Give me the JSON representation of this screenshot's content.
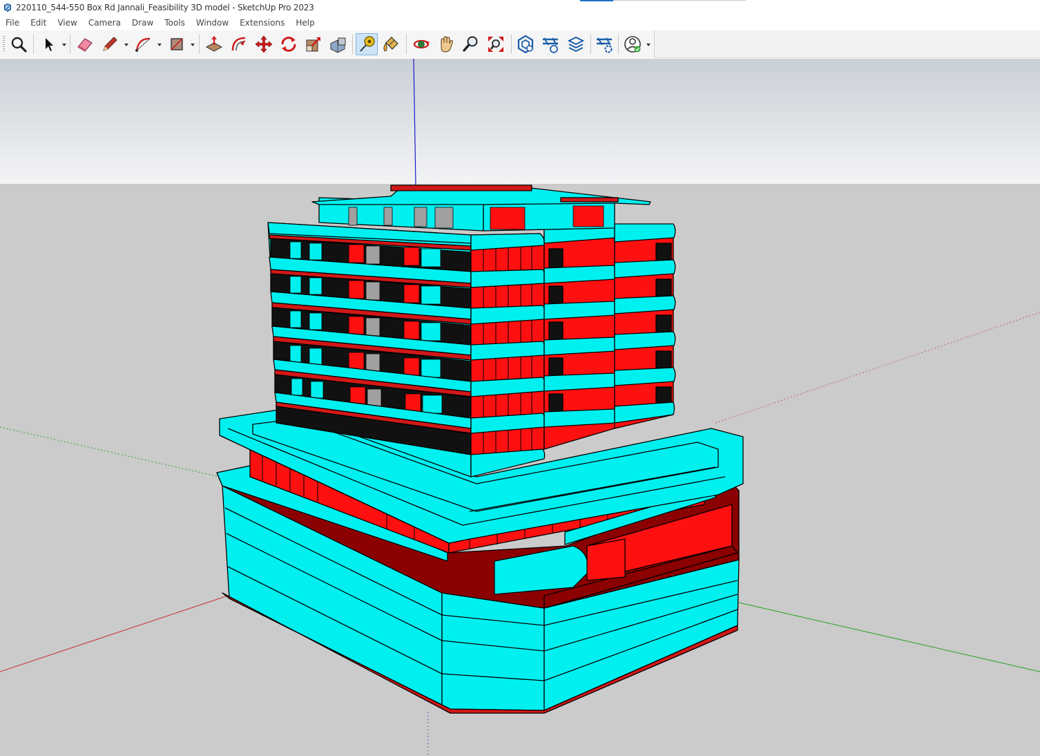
{
  "window": {
    "title": "220110_544-550 Box Rd Jannali_Feasibility 3D model - SketchUp Pro 2023"
  },
  "menu": {
    "items": [
      "File",
      "Edit",
      "View",
      "Camera",
      "Draw",
      "Tools",
      "Window",
      "Extensions",
      "Help"
    ]
  },
  "toolbar": {
    "tools": [
      {
        "name": "zoom-extents",
        "icon": "magnifier-icon"
      },
      {
        "name": "select",
        "icon": "arrow-cursor-icon"
      },
      {
        "name": "eraser",
        "icon": "eraser-icon"
      },
      {
        "name": "line",
        "icon": "pencil-icon"
      },
      {
        "name": "arc",
        "icon": "arc-icon"
      },
      {
        "name": "rectangle",
        "icon": "rectangle-icon"
      },
      {
        "name": "push-pull",
        "icon": "push-pull-icon"
      },
      {
        "name": "offset",
        "icon": "offset-icon"
      },
      {
        "name": "move",
        "icon": "move-icon"
      },
      {
        "name": "rotate",
        "icon": "rotate-icon"
      },
      {
        "name": "scale",
        "icon": "scale-icon"
      },
      {
        "name": "follow-me",
        "icon": "follow-me-icon"
      },
      {
        "name": "tape-measure",
        "icon": "tape-measure-icon",
        "active": true
      },
      {
        "name": "paint-bucket",
        "icon": "paint-bucket-icon"
      },
      {
        "name": "orbit",
        "icon": "orbit-icon"
      },
      {
        "name": "pan",
        "icon": "hand-icon"
      },
      {
        "name": "zoom",
        "icon": "zoom-icon"
      },
      {
        "name": "zoom-window",
        "icon": "zoom-window-icon"
      },
      {
        "name": "3d-warehouse",
        "icon": "warehouse-icon"
      },
      {
        "name": "extension-warehouse",
        "icon": "extension-warehouse-icon"
      },
      {
        "name": "layout",
        "icon": "layout-icon"
      },
      {
        "name": "extension-manager",
        "icon": "extension-manager-icon"
      },
      {
        "name": "trimble-account",
        "icon": "account-icon"
      }
    ]
  },
  "colors": {
    "cyan": "#00ffff",
    "red": "#ff0000",
    "dark-red": "#8b0000",
    "sky-top": "#c9cfd6",
    "sky-bottom": "#f3f4f6",
    "ground": "#cbcbcb",
    "accent": "#1e6fc9"
  }
}
